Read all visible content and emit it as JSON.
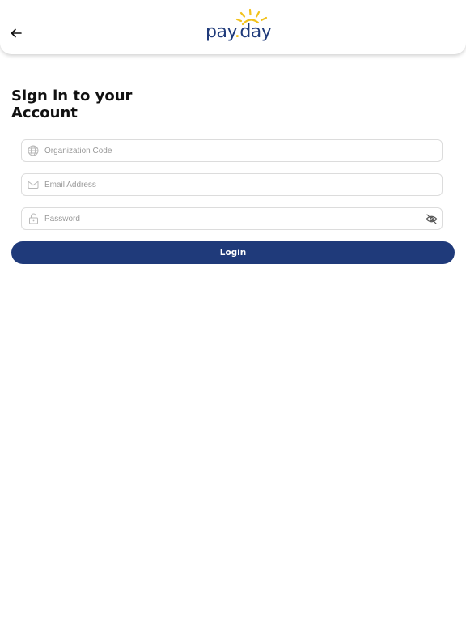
{
  "header": {
    "back_icon": "arrow-left-icon",
    "logo": {
      "text_pay": "pay",
      "text_day": "day",
      "sun_color": "#f2c21c",
      "text_color": "#1f3a7a"
    }
  },
  "title": "Sign in to your Account",
  "form": {
    "org_code": {
      "placeholder": "Organization Code",
      "value": "",
      "icon": "globe-icon"
    },
    "email": {
      "placeholder": "Email Address",
      "value": "",
      "icon": "mail-icon"
    },
    "password": {
      "placeholder": "Password",
      "value": "",
      "icon": "lock-icon",
      "toggle_icon": "eye-off-icon"
    },
    "login_label": "Login"
  },
  "colors": {
    "primary": "#1f3a7a",
    "border": "#dcdcdc",
    "placeholder": "#9a9a9a"
  }
}
